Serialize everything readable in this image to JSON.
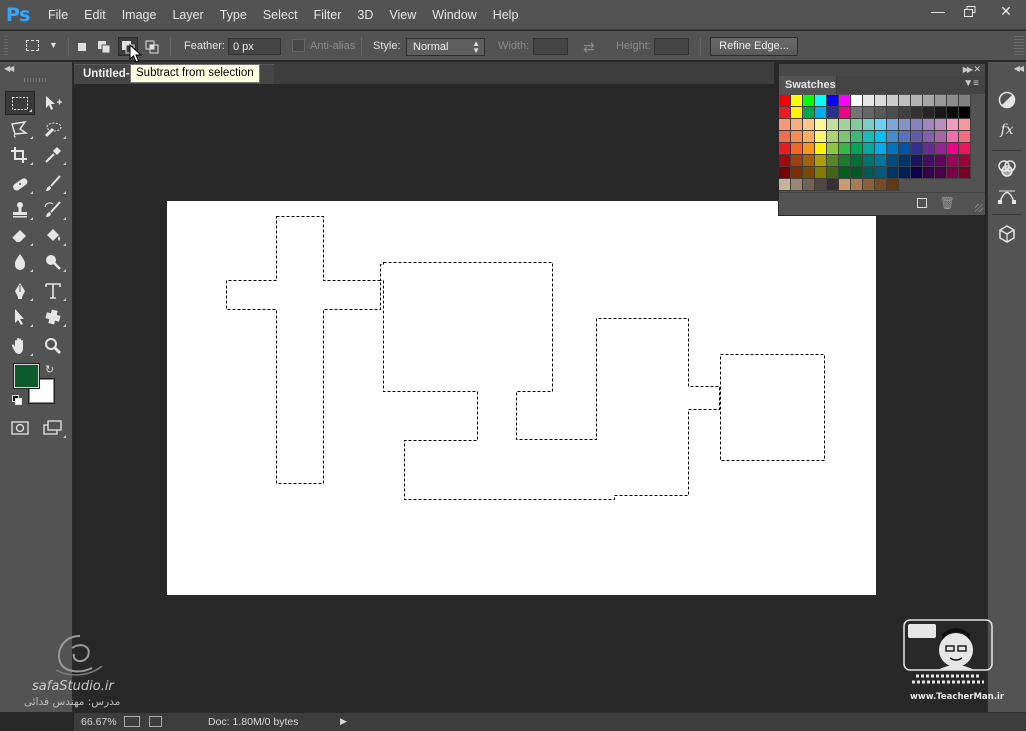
{
  "app": {
    "logo": "Ps"
  },
  "menu": [
    "File",
    "Edit",
    "Image",
    "Layer",
    "Type",
    "Select",
    "Filter",
    "3D",
    "View",
    "Window",
    "Help"
  ],
  "options_bar": {
    "feather_label": "Feather:",
    "feather_value": "0 px",
    "antialias_label": "Anti-alias",
    "style_label": "Style:",
    "style_value": "Normal",
    "width_label": "Width:",
    "height_label": "Height:",
    "refine_edge_label": "Refine Edge..."
  },
  "document": {
    "tab_title": "Untitled-1 @ 66.7% (RGB/8)"
  },
  "tooltip": {
    "text": "Subtract from selection"
  },
  "swatches": {
    "title": "Swatches",
    "rows": [
      [
        "#ff0000",
        "#ffff00",
        "#00ff00",
        "#00ffff",
        "#0000ff",
        "#ff00ff",
        "#ffffff",
        "#e6e6e6",
        "#d9d9d9",
        "#cccccc",
        "#bfbfbf",
        "#b3b3b3",
        "#a6a6a6",
        "#999999",
        "#8c8c8c",
        "#808080"
      ],
      [
        "#ed1c24",
        "#fff200",
        "#00a651",
        "#00aeef",
        "#2e3192",
        "#ec008c",
        "#737373",
        "#666666",
        "#595959",
        "#4d4d4d",
        "#404040",
        "#333333",
        "#262626",
        "#1a1a1a",
        "#0d0d0d",
        "#000000"
      ],
      [
        "#f7977a",
        "#f9ad81",
        "#fdc68a",
        "#fff79a",
        "#c4df9b",
        "#a2d39c",
        "#82ca9d",
        "#7bcdc8",
        "#6ecff6",
        "#7ea7d8",
        "#8493ca",
        "#8882be",
        "#a187be",
        "#bc8dbf",
        "#f49ac2",
        "#f6989d"
      ],
      [
        "#f26c4f",
        "#f68e55",
        "#fbaf5c",
        "#fff467",
        "#acd372",
        "#7cc576",
        "#3bb878",
        "#1abbb4",
        "#00bff3",
        "#438ccb",
        "#5574b9",
        "#605ca8",
        "#855fa8",
        "#a763a8",
        "#f06ea9",
        "#f26d7d"
      ],
      [
        "#ed1c24",
        "#f26522",
        "#f7941d",
        "#fff200",
        "#8dc63f",
        "#39b54a",
        "#00a651",
        "#00a99d",
        "#00aeef",
        "#0072bc",
        "#0054a6",
        "#2e3192",
        "#662d91",
        "#92278f",
        "#ec008c",
        "#ed145b"
      ],
      [
        "#9e0b0f",
        "#a0410d",
        "#a36209",
        "#aba000",
        "#598527",
        "#1a7b30",
        "#007236",
        "#00746b",
        "#0076a3",
        "#004b80",
        "#003471",
        "#1b1464",
        "#440e62",
        "#630460",
        "#9e005d",
        "#9e0039"
      ],
      [
        "#790000",
        "#7b2e00",
        "#7d4900",
        "#827b00",
        "#406618",
        "#005e20",
        "#005826",
        "#005952",
        "#005b7f",
        "#003663",
        "#002157",
        "#0d004c",
        "#32004b",
        "#4b0049",
        "#7b0046",
        "#7a0026"
      ],
      [
        "#c7b299",
        "#998675",
        "#736357",
        "#534741",
        "#37302d",
        "#c69c6e",
        "#a67c52",
        "#8c6239",
        "#754c24",
        "#603913"
      ]
    ]
  },
  "status": {
    "zoom": "66.67%",
    "doc": "Doc: 1.80M/0 bytes"
  },
  "watermarks": {
    "left_site": "safaStudio.ir",
    "left_credit": "مدرس: مهندس فدائی",
    "right_site": "www.TeacherMan.ir"
  },
  "colors": {
    "foreground": "#0d5a2c",
    "background": "#ffffff",
    "ps_blue": "#31a8ff"
  }
}
